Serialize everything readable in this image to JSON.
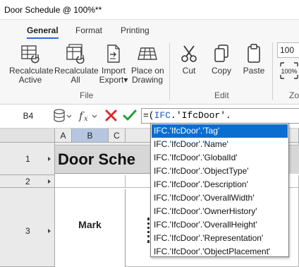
{
  "window": {
    "title": "Door Schedule @ 100%**"
  },
  "ribbon": {
    "tabs": [
      {
        "label": "General",
        "active": true
      },
      {
        "label": "Format",
        "active": false
      },
      {
        "label": "Printing",
        "active": false
      }
    ],
    "buttons": {
      "recalc_active": {
        "line1": "Recalculate",
        "line2": "Active",
        "icon": "table-recalculate-icon"
      },
      "recalc_all": {
        "line1": "Recalculate",
        "line2": "All",
        "icon": "tables-recalculate-icon"
      },
      "import_export": {
        "line1": "Import",
        "line2": "Export▾",
        "icon": "document-import-export-icon"
      },
      "place_on_drawing": {
        "line1": "Place on",
        "line2": "Drawing",
        "icon": "place-grid-icon"
      },
      "cut": {
        "line1": "Cut",
        "icon": "scissors-icon"
      },
      "copy": {
        "line1": "Copy",
        "icon": "copy-icon"
      },
      "paste": {
        "line1": "Paste",
        "icon": "clipboard-icon"
      }
    },
    "groups": {
      "file": "File",
      "edit": "Edit",
      "zoom_partial": "Zo"
    },
    "zoom": {
      "value": "100",
      "reset_label": "100%"
    }
  },
  "formula_bar": {
    "cell_ref": "B4",
    "formula_prefix": "=(",
    "formula_keyword": "IFC",
    "formula_rest": ".'IfcDoor'."
  },
  "sheet": {
    "columns": [
      "A",
      "B",
      "C"
    ],
    "selected_column": "B",
    "rows": [
      "1",
      "2",
      "3"
    ],
    "title_text": "Door Sche",
    "mark_text": "Mark"
  },
  "autocomplete": {
    "items": [
      "IFC.'IfcDoor'.'Tag'",
      "IFC.'IfcDoor'.'Name'",
      "IFC.'IfcDoor'.'GlobalId'",
      "IFC.'IfcDoor'.'ObjectType'",
      "IFC.'IfcDoor'.'Description'",
      "IFC.'IfcDoor'.'OverallWidth'",
      "IFC.'IfcDoor'.'OwnerHistory'",
      "IFC.'IfcDoor'.'OverallHeight'",
      "IFC.'IfcDoor'.'Representation'",
      "IFC.'IfcDoor'.'ObjectPlacement'"
    ],
    "selected_index": 0
  },
  "colors": {
    "accent": "#2b6bd8",
    "selection": "#0a6ed1",
    "cancel": "#e02a2a",
    "confirm": "#21a33a",
    "title_fill": "#d7d7d7"
  }
}
